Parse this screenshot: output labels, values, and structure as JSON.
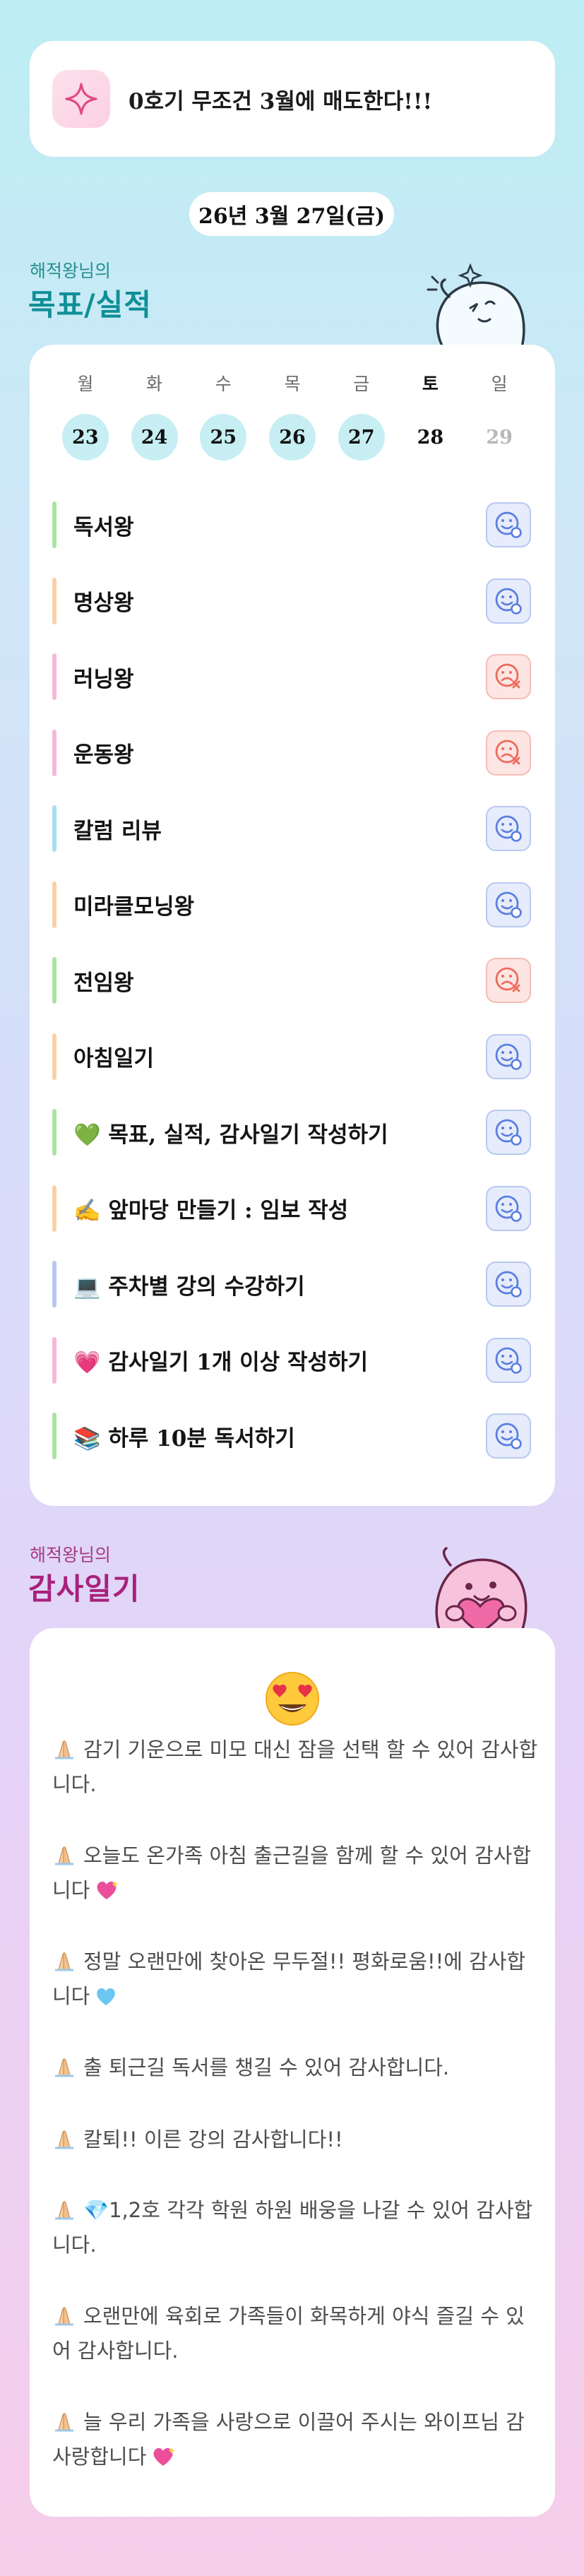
{
  "banner": {
    "icon": "sparkle-icon",
    "text": "0호기 무조건 3월에 매도한다!!!"
  },
  "date_label": "26년 3월 27일(금)",
  "goals_section": {
    "subtitle": "해적왕님의",
    "title": "목표/실적"
  },
  "week": {
    "days": [
      {
        "weekday": "월",
        "date": "23",
        "state": "done"
      },
      {
        "weekday": "화",
        "date": "24",
        "state": "done"
      },
      {
        "weekday": "수",
        "date": "25",
        "state": "done"
      },
      {
        "weekday": "목",
        "date": "26",
        "state": "done"
      },
      {
        "weekday": "금",
        "date": "27",
        "state": "done"
      },
      {
        "weekday": "토",
        "date": "28",
        "state": "today"
      },
      {
        "weekday": "일",
        "date": "29",
        "state": "future"
      }
    ]
  },
  "goals": [
    {
      "label": "독서왕",
      "bar_color": "#a9e3a3",
      "status": "smile-icon"
    },
    {
      "label": "명상왕",
      "bar_color": "#f8d2a6",
      "status": "smile-icon"
    },
    {
      "label": "러닝왕",
      "bar_color": "#f6b8d6",
      "status": "sad-x-icon"
    },
    {
      "label": "운동왕",
      "bar_color": "#f6b8d6",
      "status": "sad-x-icon"
    },
    {
      "label": "칼럼 리뷰",
      "bar_color": "#a7e0ee",
      "status": "smile-icon"
    },
    {
      "label": "미라클모닝왕",
      "bar_color": "#f8d2a6",
      "status": "smile-icon"
    },
    {
      "label": "전임왕",
      "bar_color": "#a9e3a3",
      "status": "sad-x-icon"
    },
    {
      "label": "아침일기",
      "bar_color": "#f8d2a6",
      "status": "smile-icon"
    },
    {
      "label": "💚 목표, 실적, 감사일기 작성하기",
      "bar_color": "#a9e3a3",
      "status": "smile-icon"
    },
    {
      "label": "✍️ 앞마당 만들기 : 임보 작성",
      "bar_color": "#f8d2a6",
      "status": "smile-icon"
    },
    {
      "label": "💻 주차별 강의 수강하기",
      "bar_color": "#b8c6f3",
      "status": "smile-icon"
    },
    {
      "label": "💗 감사일기 1개 이상 작성하기",
      "bar_color": "#f6b8d6",
      "status": "smile-icon"
    },
    {
      "label": "📚 하루 10분 독서하기",
      "bar_color": "#a9e3a3",
      "status": "smile-icon"
    }
  ],
  "gratitude_section": {
    "subtitle": "해적왕님의",
    "title": "감사일기",
    "mood_icon": "heart-eyes-icon"
  },
  "gratitude": [
    {
      "text": "감기 기운으로 미모 대신 잠을 선택 할 수 있어 감사합니다.",
      "trail": ""
    },
    {
      "text": "오늘도 온가족 아침 출근길을 함께 할 수 있어 감사합니다",
      "trail": "sparkle-heart"
    },
    {
      "text": "정말 오랜만에 찾아온 무두절!! 평화로움!!에 감사합니다",
      "trail": "blue-heart"
    },
    {
      "text": "출 퇴근길 독서를 챙길 수 있어 감사합니다.",
      "trail": ""
    },
    {
      "text": "칼퇴!! 이른 강의 감사합니다!!",
      "trail": ""
    },
    {
      "text": "💎1,2호 각각 학원 하원 배웅을 나갈 수 있어 감사합니다.",
      "trail": ""
    },
    {
      "text": "오랜만에 육회로 가족들이 화목하게 야식 즐길 수 있어 감사합니다.",
      "trail": ""
    },
    {
      "text": "늘 우리 가족을 사랑으로 이끌어 주시는 와이프님 감사랑합니다",
      "trail": "sparkle-heart"
    }
  ],
  "colors": {
    "goals_title": "#0f8f95",
    "goals_subtitle": "#24908f",
    "grat_title": "#a8217c",
    "grat_subtitle": "#a63a86",
    "ok_icon": "#5a7fe2",
    "fail_icon": "#ee6a5c"
  }
}
